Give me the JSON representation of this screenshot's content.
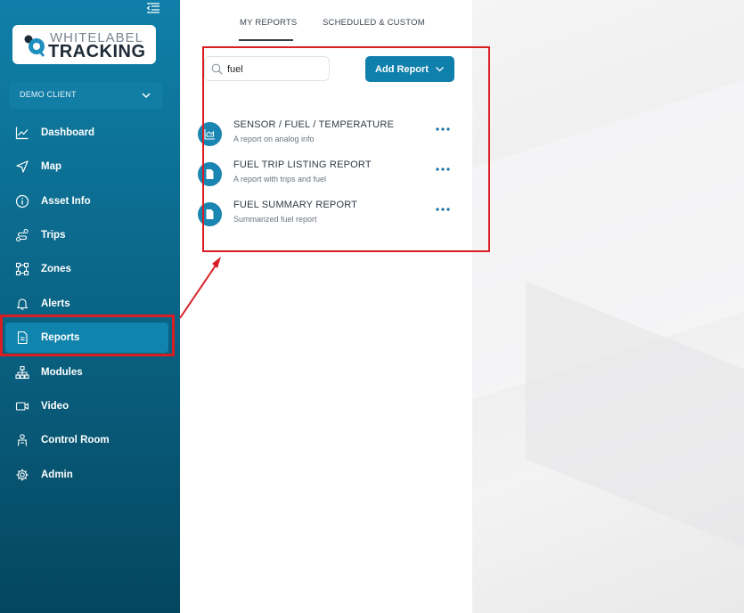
{
  "brand": {
    "logo_line1": "WHITELABEL",
    "logo_line2": "TRACKING"
  },
  "client_selector": {
    "label": "DEMO CLIENT"
  },
  "sidebar": {
    "items": [
      {
        "label": "Dashboard",
        "icon": "chart-line-icon"
      },
      {
        "label": "Map",
        "icon": "navigation-arrow-icon"
      },
      {
        "label": "Asset Info",
        "icon": "info-circle-icon"
      },
      {
        "label": "Trips",
        "icon": "route-icon"
      },
      {
        "label": "Zones",
        "icon": "zone-polygon-icon"
      },
      {
        "label": "Alerts",
        "icon": "bell-icon"
      },
      {
        "label": "Reports",
        "icon": "document-icon",
        "active": true
      },
      {
        "label": "Modules",
        "icon": "modules-tree-icon"
      },
      {
        "label": "Video",
        "icon": "video-camera-icon"
      },
      {
        "label": "Control Room",
        "icon": "control-room-icon"
      },
      {
        "label": "Admin",
        "icon": "gear-icon"
      }
    ]
  },
  "tabs": [
    {
      "label": "MY REPORTS",
      "active": true
    },
    {
      "label": "SCHEDULED & CUSTOM",
      "active": false
    }
  ],
  "search": {
    "value": "fuel",
    "placeholder": ""
  },
  "add_report": {
    "label": "Add Report"
  },
  "reports": [
    {
      "title": "SENSOR / FUEL / TEMPERATURE",
      "subtitle": "A report on analog info",
      "icon": "analog-chart-icon"
    },
    {
      "title": "FUEL TRIP LISTING REPORT",
      "subtitle": "A report with trips and fuel",
      "icon": "document-icon"
    },
    {
      "title": "FUEL SUMMARY REPORT",
      "subtitle": "Summarized fuel report",
      "icon": "document-icon"
    }
  ],
  "colors": {
    "accent": "#0f7fac",
    "highlight": "#d81d23",
    "sidebar_top": "#0f7fa9",
    "sidebar_bottom": "#04465f"
  }
}
